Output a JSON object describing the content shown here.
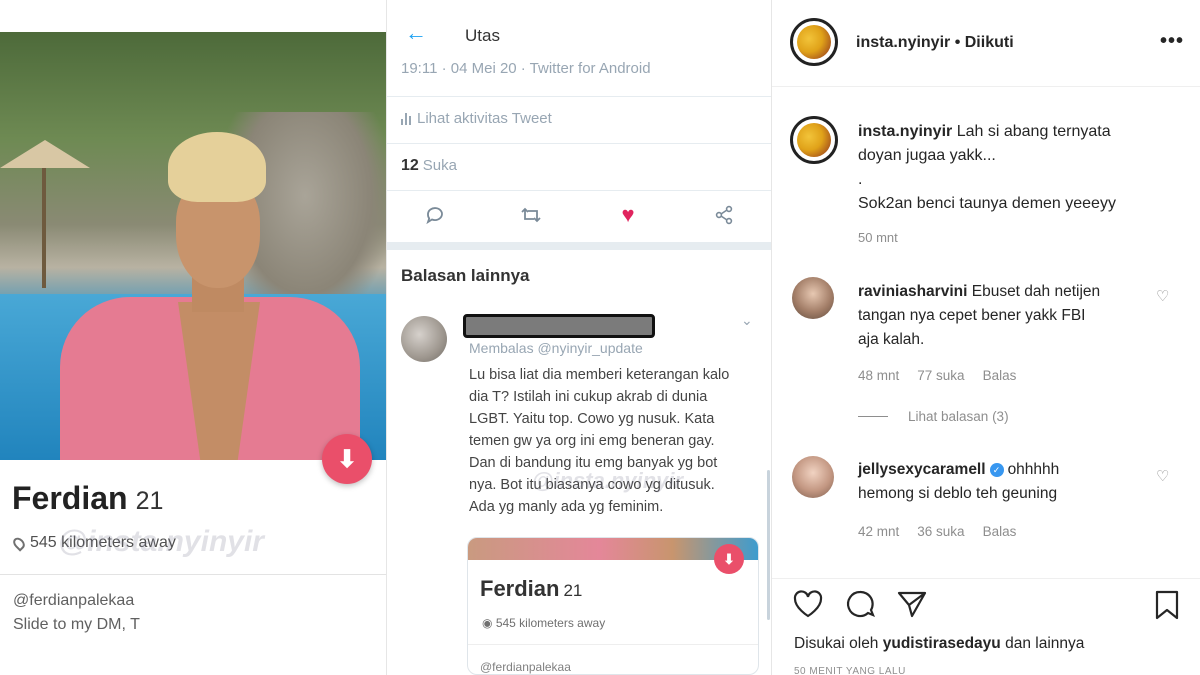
{
  "profile": {
    "name": "Ferdian",
    "age": "21",
    "distance": "545 kilometers away",
    "handle": "@ferdianpalekaa",
    "bio": "Slide to my DM, T",
    "watermark": "@insta.nyinyir",
    "action_icon": "arrow-down-icon",
    "accent_color": "#ea4f6a"
  },
  "thread": {
    "header_title": "Utas",
    "meta": "19:11 · 04 Mei 20 · Twitter for Android",
    "activity_label": "Lihat aktivitas Tweet",
    "likes_count": "12",
    "likes_label": "Suka",
    "more_replies_label": "Balasan lainnya",
    "reply": {
      "replying_to": "Membalas @nyinyir_update",
      "lines": [
        "Lu bisa liat dia memberi keterangan kalo",
        "dia T?  Istilah ini cukup akrab di dunia",
        "LGBT. Yaitu top. Cowo yg nusuk. Kata",
        "temen gw ya org ini emg beneran gay.",
        "Dan di bandung itu emg banyak yg bot",
        "nya. Bot itu biasanya cowo yg ditusuk.",
        "Ada yg manly ada yg feminim."
      ],
      "card": {
        "name": "Ferdian",
        "age": "21",
        "distance": "545 kilometers away",
        "handle": "@ferdianpalekaa"
      }
    },
    "watermark": "@insta.nyinyir",
    "like_color": "#e0245e"
  },
  "instagram": {
    "username": "insta.nyinyir",
    "follow_status": "• Diikuti",
    "caption": {
      "username": "insta.nyinyir",
      "line1": "Lah si abang ternyata",
      "line2": "doyan jugaa yakk...",
      "line3": ".",
      "line4": "Sok2an benci taunya demen yeeeyy",
      "time": "50 mnt"
    },
    "comments": [
      {
        "username": "raviniasharvini",
        "line1": "Ebuset dah netijen",
        "line2": "tangan nya cepet bener yakk FBI",
        "line3": "aja kalah.",
        "time": "48 mnt",
        "likes": "77 suka",
        "reply": "Balas",
        "view_replies": "Lihat balasan (3)"
      },
      {
        "username": "jellysexycaramell",
        "line1": "ohhhhh",
        "line2": "hemong si deblo teh geuning",
        "time": "42 mnt",
        "likes": "36 suka",
        "reply": "Balas"
      }
    ],
    "liked_by_prefix": "Disukai oleh",
    "liked_by_user": "yudistirasedayu",
    "liked_by_suffix": "dan lainnya",
    "post_time": "50 MENIT YANG LALU",
    "verified_color": "#3897f0"
  }
}
